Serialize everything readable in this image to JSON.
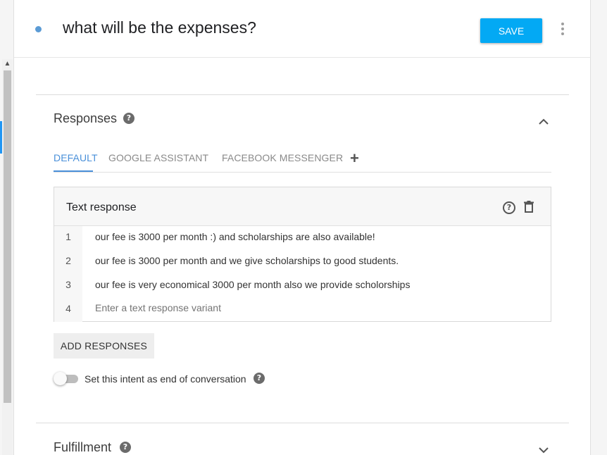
{
  "header": {
    "title": "what will be the expenses?",
    "save_label": "SAVE"
  },
  "responses_section": {
    "title": "Responses",
    "tabs": [
      {
        "label": "DEFAULT"
      },
      {
        "label": "GOOGLE ASSISTANT"
      },
      {
        "label": "FACEBOOK MESSENGER"
      }
    ],
    "add_tab_symbol": "+",
    "text_response": {
      "title": "Text response",
      "rows": [
        {
          "num": "1",
          "text": "our fee is 3000 per month :) and scholarships are also available!"
        },
        {
          "num": "2",
          "text": "our fee is 3000 per month and we give scholarships to good students."
        },
        {
          "num": "3",
          "text": "our fee is very economical 3000 per month also we provide scholorships"
        },
        {
          "num": "4",
          "placeholder": "Enter a text response variant"
        }
      ]
    },
    "add_responses_label": "ADD RESPONSES",
    "end_conversation": {
      "label": "Set this intent as end of conversation",
      "enabled": false
    }
  },
  "fulfillment_section": {
    "title": "Fulfillment"
  },
  "colors": {
    "accent": "#03a9f4",
    "tab_active": "#4a90d9"
  }
}
